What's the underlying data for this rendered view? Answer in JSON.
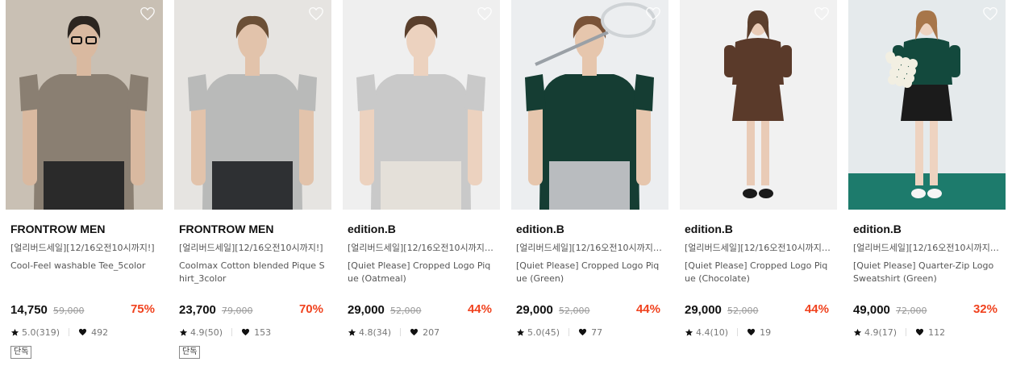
{
  "products": [
    {
      "brand": "FRONTROW MEN",
      "promo": "[얼리버드세일][12/16오전10시까지!]",
      "name": "Cool-Feel washable Tee_5color",
      "price": "14,750",
      "original_price": "59,000",
      "discount": "75%",
      "rating": "5.0(319)",
      "likes": "492",
      "badge": "단독",
      "photo": {
        "bg": "#c9c0b4",
        "top": "#8a7f72",
        "bottom": "#2a2a2a",
        "hair": "#2b2520",
        "skin": "#d9b9a0",
        "glasses": true
      }
    },
    {
      "brand": "FRONTROW MEN",
      "promo": "[얼리버드세일][12/16오전10시까지!]",
      "name": "Coolmax Cotton blended Pique Shirt_3color",
      "price": "23,700",
      "original_price": "79,000",
      "discount": "70%",
      "rating": "4.9(50)",
      "likes": "153",
      "badge": "단독",
      "photo": {
        "bg": "#e6e4e1",
        "top": "#b9bab9",
        "bottom": "#2e3033",
        "hair": "#6b4f36",
        "skin": "#e2c3ab"
      }
    },
    {
      "brand": "edition.B",
      "promo": "[얼리버드세일][12/16오전10시까지!] ...",
      "name": "[Quiet Please] Cropped Logo Pique (Oatmeal)",
      "price": "29,000",
      "original_price": "52,000",
      "discount": "44%",
      "rating": "4.8(34)",
      "likes": "207",
      "photo": {
        "bg": "#efefef",
        "top": "#c9c9c9",
        "bottom": "#e4e0d9",
        "hair": "#5a3f2c",
        "skin": "#ecd2bf"
      }
    },
    {
      "brand": "edition.B",
      "promo": "[얼리버드세일][12/16오전10시까지!] ...",
      "name": "[Quiet Please] Cropped Logo Pique (Green)",
      "price": "29,000",
      "original_price": "52,000",
      "discount": "44%",
      "rating": "5.0(45)",
      "likes": "77",
      "photo": {
        "bg": "#eceef0",
        "top": "#153d33",
        "bottom": "#b9bcbf",
        "hair": "#7a5338",
        "skin": "#e6c6ad",
        "racket": true
      }
    },
    {
      "brand": "edition.B",
      "promo": "[얼리버드세일][12/16오전10시까지!] ...",
      "name": "[Quiet Please] Cropped Logo Pique (Chocolate)",
      "price": "29,000",
      "original_price": "52,000",
      "discount": "44%",
      "rating": "4.4(10)",
      "likes": "19",
      "photo": {
        "bg": "#f1f1f1",
        "top": "#5a3a2a",
        "bottom": "#5a3a2a",
        "hair": "#5c3f2d",
        "skin": "#e9cbb6",
        "fullbody": true
      }
    },
    {
      "brand": "edition.B",
      "promo": "[얼리버드세일][12/16오전10시까지!] ...",
      "name": "[Quiet Please] Quarter-Zip Logo Sweatshirt (Green)",
      "price": "49,000",
      "original_price": "72,000",
      "discount": "32%",
      "rating": "4.9(17)",
      "likes": "112",
      "photo": {
        "bg": "#e5eaec",
        "floor": "#1d7b6c",
        "top": "#13493d",
        "bottom": "#1b1b1b",
        "hair": "#a7764a",
        "skin": "#eed3c0",
        "flowers": true,
        "fullbody": true
      }
    }
  ],
  "colors": {
    "discount": "#f0421e",
    "text": "#111111",
    "muted": "#555555"
  },
  "icons": {
    "wishlist": "heart-outline-icon",
    "rating": "star-icon",
    "likes": "heart-filled-icon"
  }
}
